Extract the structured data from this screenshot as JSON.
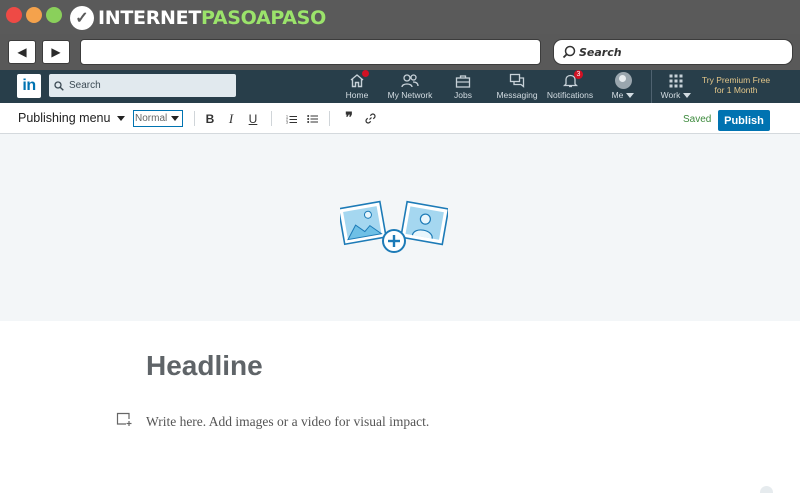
{
  "watermark": {
    "text_white_1": "INTERNET",
    "text_green": "PASOAPASO",
    "text_white_2": ""
  },
  "browser": {
    "search_placeholder": "Search"
  },
  "linkedin": {
    "search_placeholder": "Search",
    "nav": [
      {
        "label": "Home",
        "icon": "home-icon",
        "badge": ""
      },
      {
        "label": "My Network",
        "icon": "network-icon",
        "badge": ""
      },
      {
        "label": "Jobs",
        "icon": "briefcase-icon",
        "badge": ""
      },
      {
        "label": "Messaging",
        "icon": "messaging-icon",
        "badge": ""
      },
      {
        "label": "Notifications",
        "icon": "bell-icon",
        "badge": "3"
      },
      {
        "label": "Me",
        "icon": "avatar-icon",
        "badge": ""
      },
      {
        "label": "Work",
        "icon": "grid-icon",
        "badge": ""
      }
    ],
    "premium": "Try Premium Free for 1 Month"
  },
  "editor": {
    "publishing_menu": "Publishing menu",
    "style_value": "Normal",
    "bold": "B",
    "italic": "I",
    "underline": "U",
    "saved": "Saved",
    "publish": "Publish",
    "headline_placeholder": "Headline",
    "body_placeholder": "Write here. Add images or a video for visual impact."
  },
  "colors": {
    "brand": "#0073b1",
    "nav_bg": "#283e4a",
    "badge": "#d11124",
    "saved": "#3e8b3e",
    "cover_bg": "#f3f6f8"
  }
}
